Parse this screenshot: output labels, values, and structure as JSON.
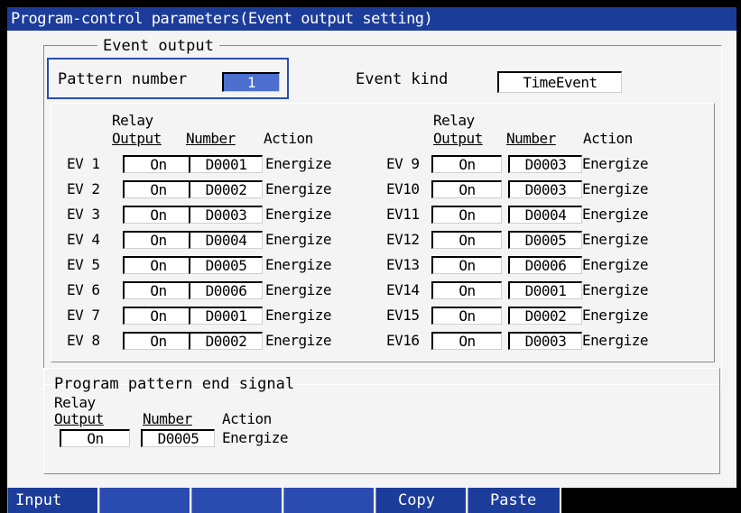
{
  "title": "Program-control parameters(Event output setting)",
  "event_output": {
    "group_label": "Event output",
    "pattern_number_label": "Pattern number",
    "pattern_number_value": "1",
    "event_kind_label": "Event kind",
    "event_kind_value": "TimeEvent",
    "headers": {
      "relay_line1": "Relay",
      "relay_line2": "Output",
      "number": "Number",
      "action": "Action"
    },
    "events_left": [
      {
        "label": "EV 1",
        "relay": "On",
        "number": "D0001",
        "action": "Energize"
      },
      {
        "label": "EV 2",
        "relay": "On",
        "number": "D0002",
        "action": "Energize"
      },
      {
        "label": "EV 3",
        "relay": "On",
        "number": "D0003",
        "action": "Energize"
      },
      {
        "label": "EV 4",
        "relay": "On",
        "number": "D0004",
        "action": "Energize"
      },
      {
        "label": "EV 5",
        "relay": "On",
        "number": "D0005",
        "action": "Energize"
      },
      {
        "label": "EV 6",
        "relay": "On",
        "number": "D0006",
        "action": "Energize"
      },
      {
        "label": "EV 7",
        "relay": "On",
        "number": "D0001",
        "action": "Energize"
      },
      {
        "label": "EV 8",
        "relay": "On",
        "number": "D0002",
        "action": "Energize"
      }
    ],
    "events_right": [
      {
        "label": "EV 9",
        "relay": "On",
        "number": "D0003",
        "action": "Energize"
      },
      {
        "label": "EV10",
        "relay": "On",
        "number": "D0003",
        "action": "Energize"
      },
      {
        "label": "EV11",
        "relay": "On",
        "number": "D0004",
        "action": "Energize"
      },
      {
        "label": "EV12",
        "relay": "On",
        "number": "D0005",
        "action": "Energize"
      },
      {
        "label": "EV13",
        "relay": "On",
        "number": "D0006",
        "action": "Energize"
      },
      {
        "label": "EV14",
        "relay": "On",
        "number": "D0001",
        "action": "Energize"
      },
      {
        "label": "EV15",
        "relay": "On",
        "number": "D0002",
        "action": "Energize"
      },
      {
        "label": "EV16",
        "relay": "On",
        "number": "D0003",
        "action": "Energize"
      }
    ]
  },
  "end_signal": {
    "title": "Program pattern end signal",
    "relay_line1": "Relay",
    "relay_line2": "Output",
    "number_label": "Number",
    "action_label": "Action",
    "relay_value": "On",
    "number_value": "D0005",
    "action_value": "Energize"
  },
  "softkeys": [
    {
      "label": "Input"
    },
    {
      "label": ""
    },
    {
      "label": ""
    },
    {
      "label": ""
    },
    {
      "label": "Copy"
    },
    {
      "label": "Paste"
    },
    {
      "label": ""
    }
  ],
  "colors": {
    "title_bar": "#1c3c9a",
    "focus_border": "#2a4bb0",
    "selected_field": "#4c6fd0",
    "panel": "#f4f4f4"
  }
}
